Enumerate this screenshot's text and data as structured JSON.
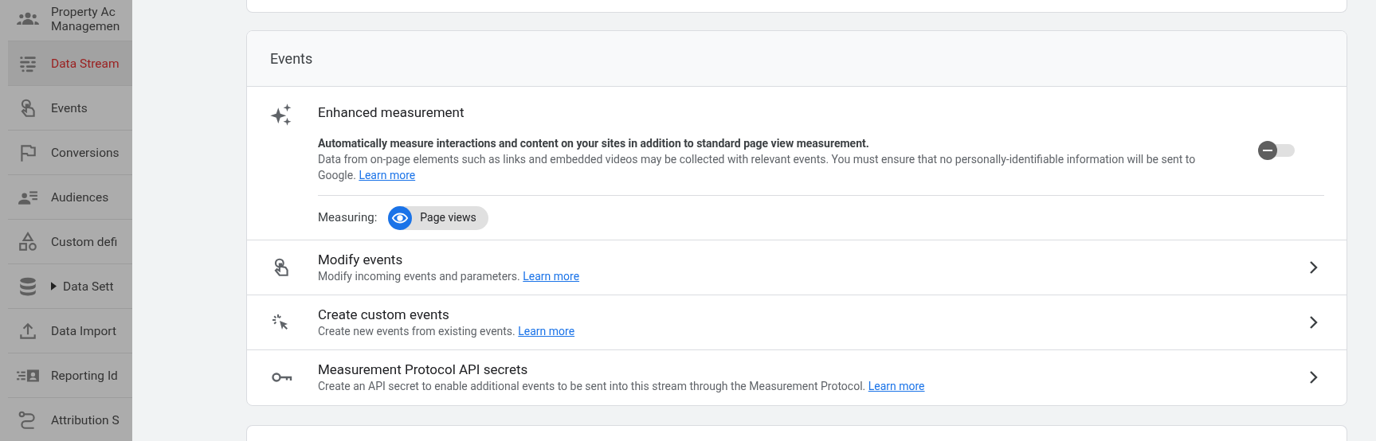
{
  "sidebar": {
    "items": [
      {
        "label": "Property Ac\nManagemen",
        "selected": false,
        "expandable": false
      },
      {
        "label": "Data Stream",
        "selected": true,
        "expandable": false
      },
      {
        "label": "Events",
        "selected": false,
        "expandable": false
      },
      {
        "label": "Conversions",
        "selected": false,
        "expandable": false
      },
      {
        "label": "Audiences",
        "selected": false,
        "expandable": false
      },
      {
        "label": "Custom defi",
        "selected": false,
        "expandable": false
      },
      {
        "label": "Data Sett",
        "selected": false,
        "expandable": true
      },
      {
        "label": "Data Import",
        "selected": false,
        "expandable": false
      },
      {
        "label": "Reporting Id",
        "selected": false,
        "expandable": false
      },
      {
        "label": "Attribution S",
        "selected": false,
        "expandable": false
      }
    ]
  },
  "events_card": {
    "title": "Events",
    "enhanced_measurement": {
      "title": "Enhanced measurement",
      "summary": "Automatically measure interactions and content on your sites in addition to standard page view measurement.",
      "description": "Data from on-page elements such as links and embedded videos may be collected with relevant events. You must ensure that no personally-identifiable information will be sent to Google.",
      "link": "Learn more",
      "on": false,
      "measuring_label": "Measuring:",
      "chips": [
        {
          "label": "Page views"
        }
      ]
    },
    "rows": [
      {
        "title": "Modify events",
        "description": "Modify incoming events and parameters.",
        "link": "Learn more"
      },
      {
        "title": "Create custom events",
        "description": "Create new events from existing events.",
        "link": "Learn more"
      },
      {
        "title": "Measurement Protocol API secrets",
        "description": "Create an API secret to enable additional events to be sent into this stream through the Measurement Protocol.",
        "link": "Learn more"
      }
    ]
  }
}
